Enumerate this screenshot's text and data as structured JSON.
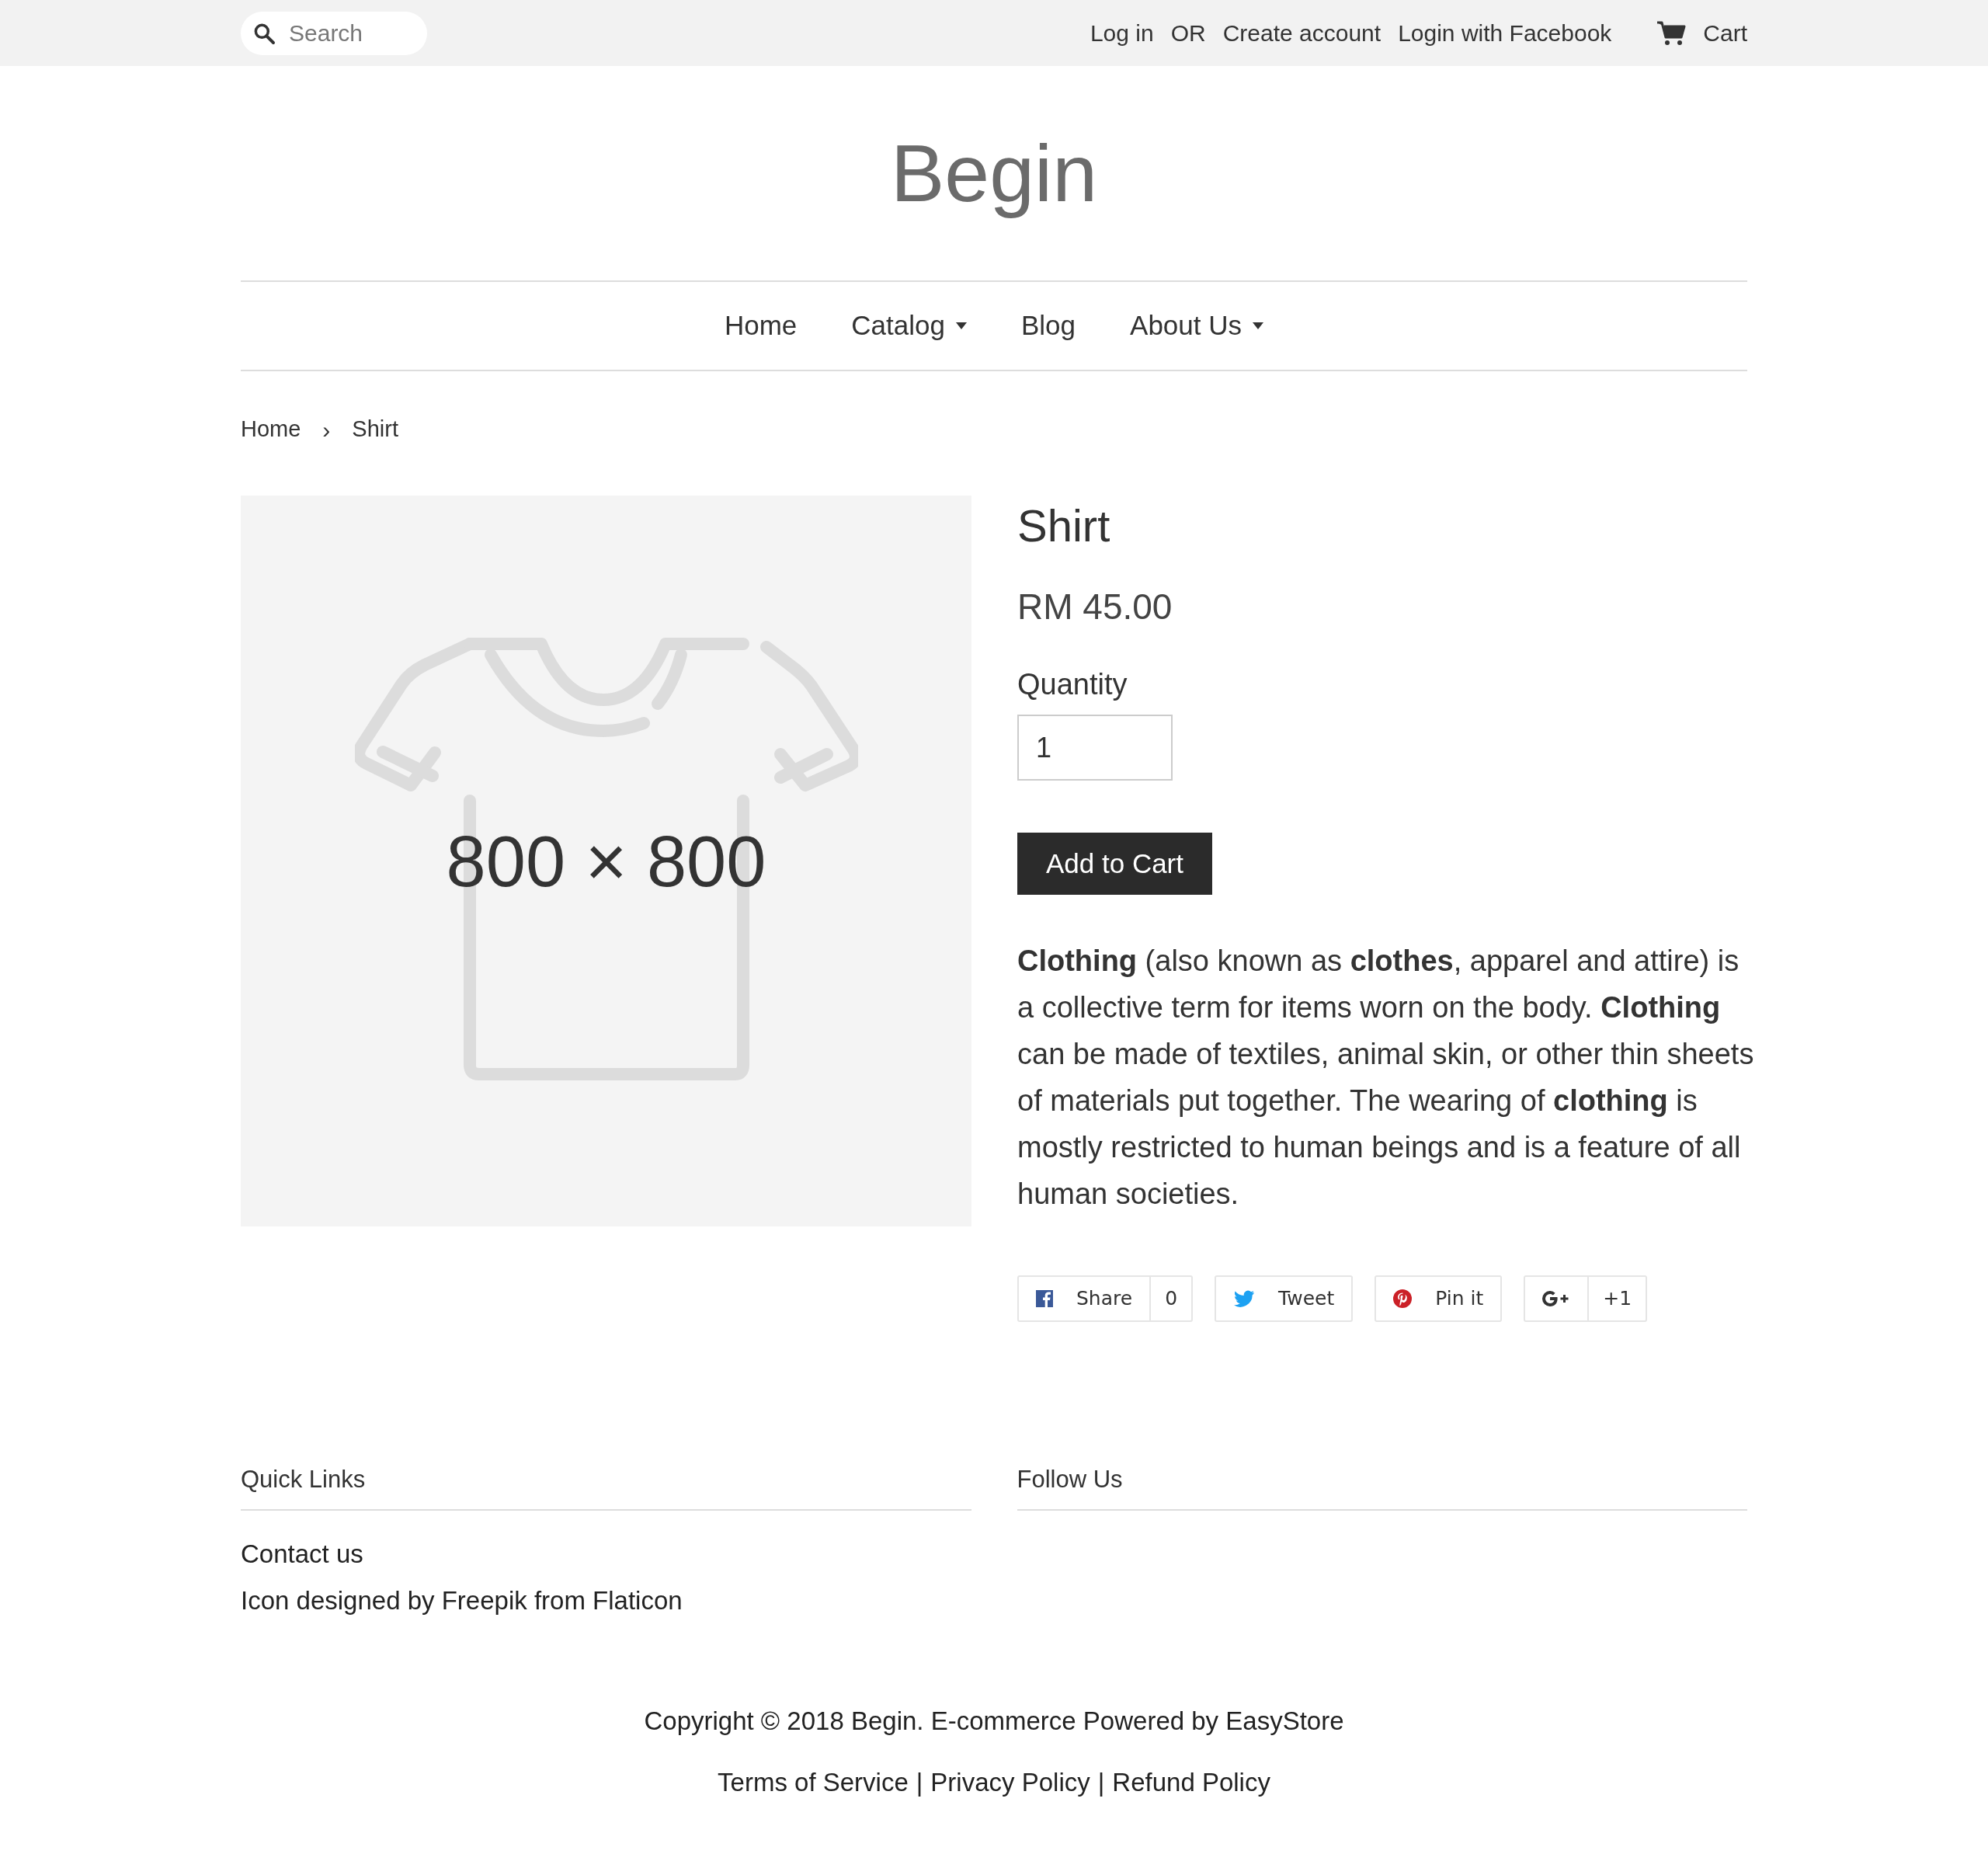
{
  "top_bar": {
    "search": {
      "placeholder": "Search"
    },
    "links": [
      {
        "label": "Log in"
      },
      {
        "label": "OR"
      },
      {
        "label": "Create account"
      },
      {
        "label": "Login with Facebook"
      }
    ],
    "cart": "Cart"
  },
  "logo": "Begin",
  "nav": [
    {
      "label": "Home",
      "has_dropdown": false
    },
    {
      "label": "Catalog",
      "has_dropdown": true
    },
    {
      "label": "Blog",
      "has_dropdown": false
    },
    {
      "label": "About Us",
      "has_dropdown": true
    }
  ],
  "breadcrumb": [
    "Home",
    "Shirt"
  ],
  "breadcrumb_separator": "›",
  "product": {
    "image_label": "800 × 800",
    "title": "Shirt",
    "price": "RM 45.00",
    "quantity_label": "Quantity",
    "quantity": "1",
    "add_button": "Add to Cart",
    "description": "**Clothing** (also known as  **clothes**, apparel and attire) is a collective term for items worn on the body.  **Clothing** can be made of textiles, animal skin, or other thin sheets of materials put together. The wearing of  **clothing** is mostly restricted to human beings and is a feature of all human societies.",
    "social": [
      {
        "kind": "facebook",
        "label": "Share",
        "count": "0"
      },
      {
        "kind": "twitter",
        "label": "Tweet"
      },
      {
        "kind": "pinterest",
        "label": "Pin it"
      },
      {
        "kind": "gplus",
        "label": "+1"
      }
    ]
  },
  "footer": {
    "columns": [
      {
        "title": "Quick Links",
        "links": [
          "Contact us",
          "Icon designed by Freepik from Flaticon"
        ]
      },
      {
        "title": "Follow Us"
      }
    ],
    "copyright": "Copyright © 2018 Begin. E-commerce Powered by EasyStore",
    "policies": [
      "Terms of Service",
      "Privacy Policy",
      "Refund Policy"
    ],
    "policy_separator": "|"
  }
}
